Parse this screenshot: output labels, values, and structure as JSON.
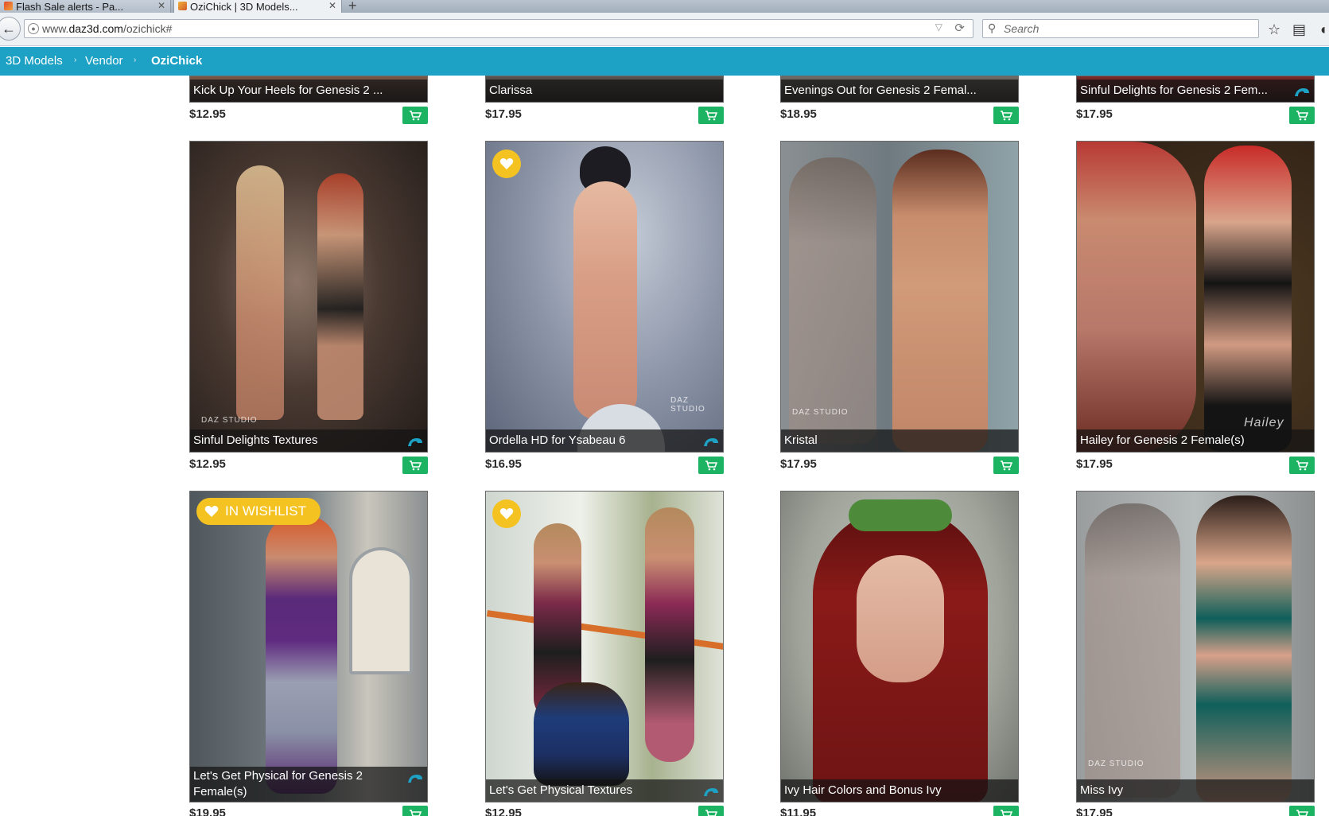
{
  "browser": {
    "tabs": [
      {
        "label": "Flash Sale alerts - Pa..."
      },
      {
        "label": "OziChick | 3D Models..."
      }
    ],
    "url_prefix": "www.",
    "url_host": "daz3d.com",
    "url_path": "/ozichick#",
    "search_placeholder": "Search"
  },
  "breadcrumb": {
    "items": [
      "3D Models",
      "Vendor",
      "OziChick"
    ],
    "separator": "›"
  },
  "products": [
    {
      "title": "Kick Up Your Heels for Genesis 2 ...",
      "price": "$12.95",
      "iray": false
    },
    {
      "title": "Clarissa",
      "price": "$17.95",
      "iray": false
    },
    {
      "title": "Evenings Out for Genesis 2 Femal...",
      "price": "$18.95",
      "iray": false
    },
    {
      "title": "Sinful Delights for Genesis 2 Fem...",
      "price": "$17.95",
      "iray": true
    },
    {
      "title": "Sinful Delights Textures",
      "price": "$12.95",
      "iray": true
    },
    {
      "title": "Ordella HD for Ysabeau 6",
      "price": "$16.95",
      "iray": true,
      "wishlisted": true
    },
    {
      "title": "Kristal",
      "price": "$17.95",
      "iray": false
    },
    {
      "title": "Hailey for Genesis 2 Female(s)",
      "price": "$17.95",
      "iray": false
    },
    {
      "title": "Let's Get Physical for Genesis 2 Female(s)",
      "price": "$19.95",
      "iray": true,
      "wishlist_label": "IN WISHLIST"
    },
    {
      "title": "Let's Get Physical Textures",
      "price": "$12.95",
      "iray": true,
      "wishlisted": true
    },
    {
      "title": "Ivy Hair Colors and Bonus Ivy",
      "price": "$11.95",
      "iray": false
    },
    {
      "title": "Miss Ivy",
      "price": "$17.95",
      "iray": false
    }
  ],
  "colors": {
    "accent_bar": "#1da1c4",
    "cart_button": "#1cb462",
    "wishlist_badge": "#f4c322"
  }
}
